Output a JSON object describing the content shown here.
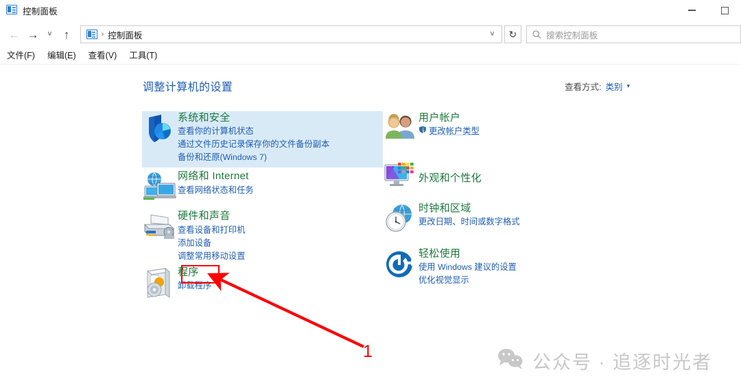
{
  "window": {
    "title": "控制面板",
    "title_icon": "control-panel-icon",
    "minimize_label": "—",
    "maximize_label": "□"
  },
  "nav": {
    "back_icon": "back-arrow-icon",
    "forward_icon": "forward-arrow-icon",
    "history_icon": "chevron-down-icon",
    "up_icon": "up-arrow-icon",
    "address": {
      "icon": "control-panel-icon",
      "separator": "›",
      "path": "控制面板",
      "dropdown_icon": "chevron-down-icon"
    },
    "refresh_icon": "refresh-icon",
    "search": {
      "icon": "search-icon",
      "placeholder": "搜索控制面板"
    }
  },
  "menubar": {
    "items": [
      {
        "label": "文件(F)"
      },
      {
        "label": "编辑(E)"
      },
      {
        "label": "查看(V)"
      },
      {
        "label": "工具(T)"
      }
    ]
  },
  "main": {
    "page_title": "调整计算机的设置",
    "view_by": {
      "label": "查看方式:",
      "value": "类别",
      "caret": "▾"
    },
    "categories_left": [
      {
        "icon": "shield-security-icon",
        "title": "系统和安全",
        "links": [
          "查看你的计算机状态",
          "通过文件历史记录保存你的文件备份副本",
          "备份和还原(Windows 7)"
        ]
      },
      {
        "icon": "network-globe-monitors-icon",
        "title": "网络和 Internet",
        "links": [
          "查看网络状态和任务"
        ]
      },
      {
        "icon": "printer-hardware-icon",
        "title": "硬件和声音",
        "links": [
          "查看设备和打印机",
          "添加设备",
          "调整常用移动设置"
        ]
      },
      {
        "icon": "programs-disc-box-icon",
        "title": "程序",
        "links": [
          "卸载程序"
        ]
      }
    ],
    "categories_right": [
      {
        "icon": "user-accounts-people-icon",
        "title": "用户帐户",
        "links": [
          "更改帐户类型"
        ],
        "uac_first_link": true
      },
      {
        "icon": "appearance-monitor-icon",
        "title": "外观和个性化",
        "links": []
      },
      {
        "icon": "clock-globe-icon",
        "title": "时钟和区域",
        "links": [
          "更改日期、时间或数字格式"
        ]
      },
      {
        "icon": "ease-of-access-icon",
        "title": "轻松使用",
        "links": [
          "使用 Windows 建议的设置",
          "优化视觉显示"
        ]
      }
    ]
  },
  "annotation": {
    "number": "1",
    "color": "#ff0000",
    "target": "程序"
  },
  "watermark": {
    "icon": "wechat-icon",
    "text": "公众号 · 追逐时光者",
    "color": "#c8c8c8"
  },
  "colors": {
    "category_title": "#1d7a3e",
    "link": "#1f5eb4",
    "page_title": "#1f5eb4",
    "highlight_band": "#d9eaf7",
    "annotation": "#ff0000"
  }
}
